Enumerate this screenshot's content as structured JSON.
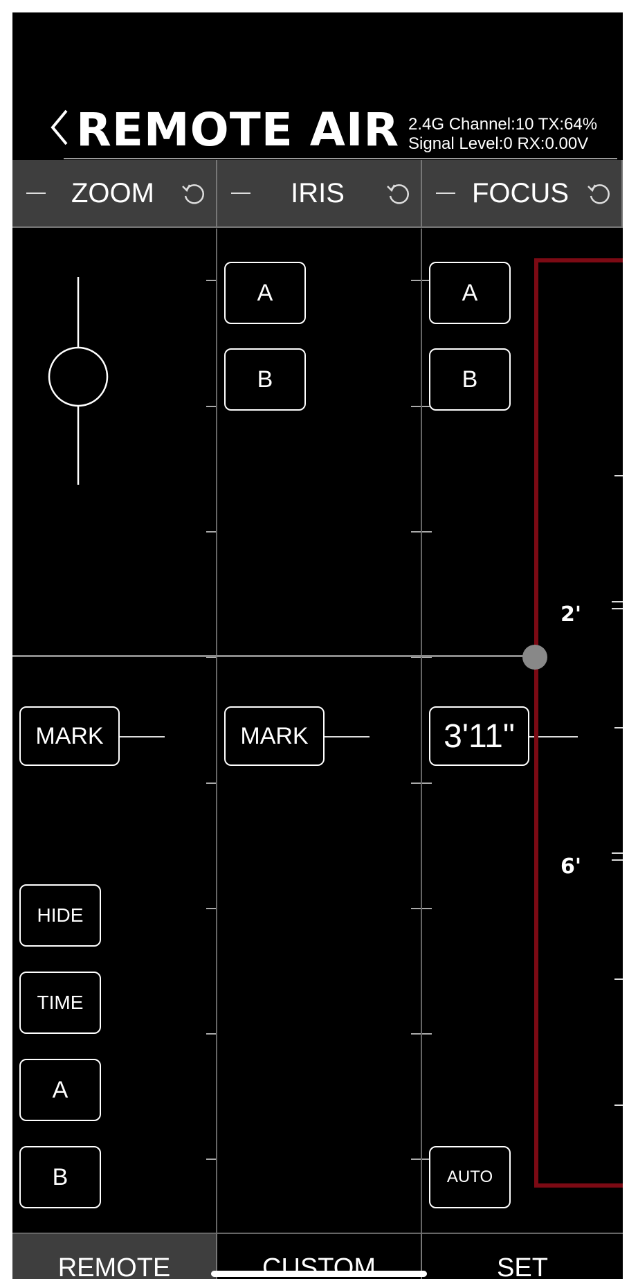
{
  "header": {
    "title": "REMOTE AIR",
    "status_line1": "2.4G Channel:10 TX:64%",
    "status_line2": "Signal Level:0 RX:0.00V"
  },
  "axes": [
    {
      "label": "ZOOM",
      "minus": "-",
      "reset_icon": "reset-icon"
    },
    {
      "label": "IRIS",
      "minus": "-",
      "reset_icon": "reset-icon"
    },
    {
      "label": "FOCUS",
      "minus": "-",
      "reset_icon": "reset-icon"
    }
  ],
  "zoom": {
    "mark_label": "MARK",
    "hide_label": "HIDE",
    "time_label": "TIME",
    "a_label": "A",
    "b_label": "B"
  },
  "iris": {
    "a_label": "A",
    "b_label": "B",
    "mark_label": "MARK"
  },
  "focus": {
    "a_label": "A",
    "b_label": "B",
    "value": "3'11\"",
    "auto_label": "AUTO",
    "scale_labels": [
      "2'",
      "6'"
    ]
  },
  "tabs": [
    {
      "label": "REMOTE",
      "active": true
    },
    {
      "label": "CUSTOM",
      "active": false
    },
    {
      "label": "SET",
      "active": false
    }
  ],
  "colors": {
    "background": "#000000",
    "header_row": "#3e3e3e",
    "scale_frame": "#7c0a14",
    "knob": "#888888"
  }
}
